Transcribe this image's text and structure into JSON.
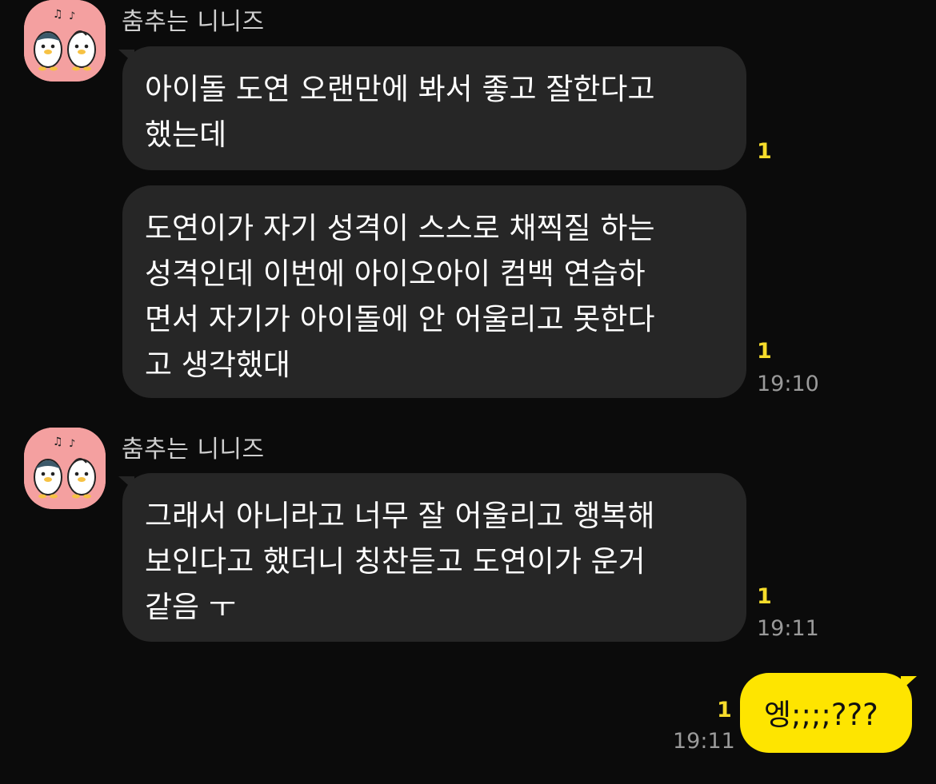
{
  "sender_name": "춤추는 니니즈",
  "groups": [
    {
      "messages": [
        {
          "lines": [
            "아이돌 도연 오랜만에 봐서 좋고 잘한다고",
            "했는데"
          ],
          "unread": "1"
        },
        {
          "lines": [
            "도연이가 자기 성격이 스스로 채찍질 하는",
            "성격인데 이번에 아이오아이 컴백 연습하",
            "면서 자기가 아이돌에 안 어울리고 못한다",
            "고 생각했대"
          ],
          "unread": "1",
          "time": "19:10"
        }
      ]
    },
    {
      "messages": [
        {
          "lines": [
            "그래서 아니라고 너무 잘 어울리고 행복해",
            "보인다고 했더니 칭찬듣고 도연이가 운거",
            "같음 ㅜ"
          ],
          "unread": "1",
          "time": "19:11"
        }
      ]
    }
  ],
  "my_message": {
    "text": "엥;;;;???",
    "unread": "1",
    "time": "19:11"
  },
  "colors": {
    "background": "#0b0b0b",
    "bubble_other": "#262626",
    "bubble_mine": "#fee500",
    "unread": "#f6dc2b",
    "avatar_bg": "#f4a0a0"
  },
  "icons": {
    "avatar": "penguin-duo-avatar-icon"
  }
}
